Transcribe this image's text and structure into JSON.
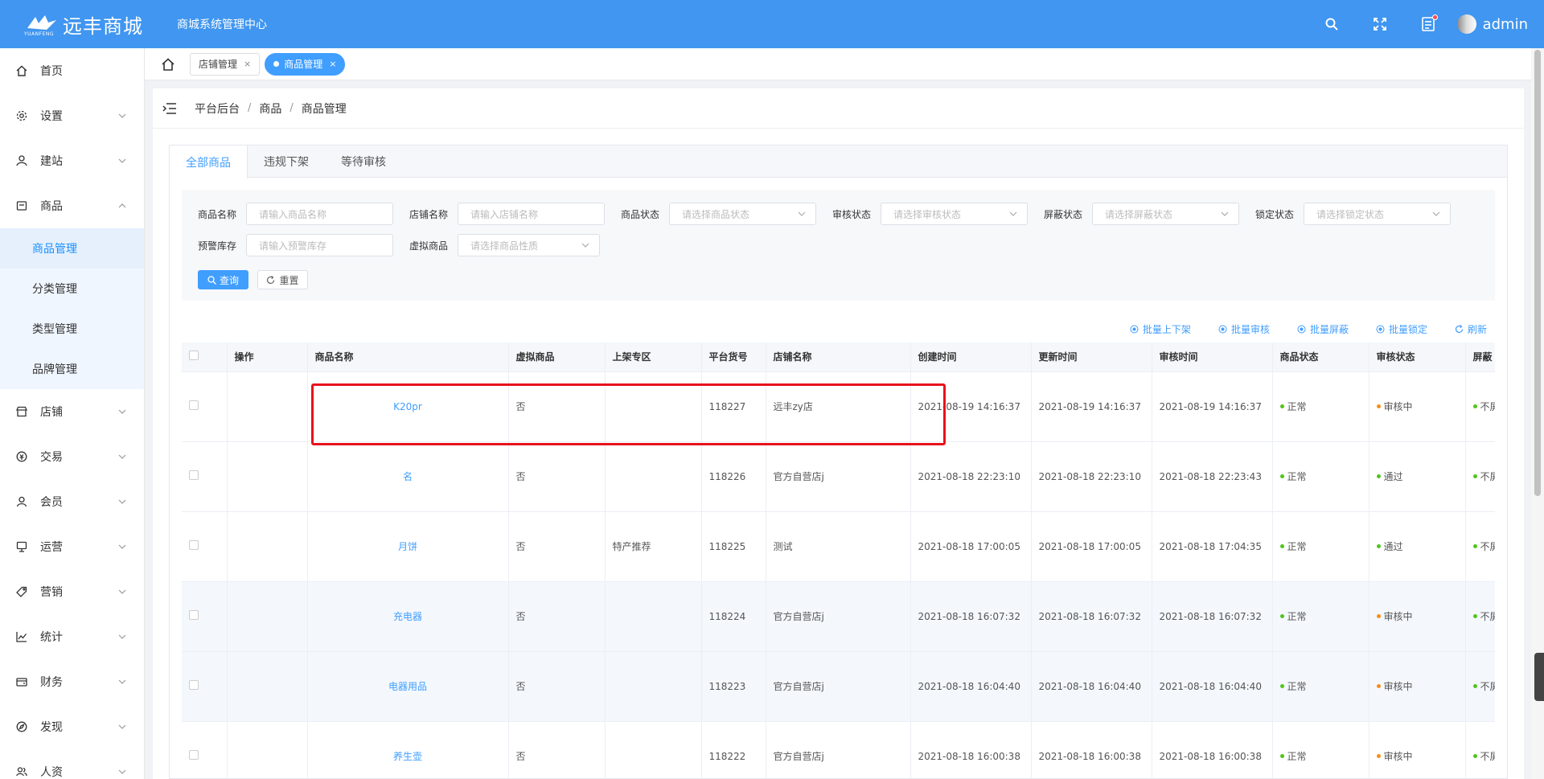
{
  "app": {
    "logo_text": "远丰商城",
    "logo_sub": "YUANFENG",
    "system_name": "商城系统管理中心",
    "username": "admin",
    "colors": {
      "primary": "#4096f0",
      "link": "#409eff",
      "highlight": "#e8121c",
      "status_green": "#52c41a",
      "status_orange": "#fa8c16"
    }
  },
  "header_icons": [
    "search-icon",
    "fullscreen-icon",
    "message-icon"
  ],
  "sidebar": {
    "items": [
      {
        "label": "首页",
        "icon": "home-icon",
        "expandable": false
      },
      {
        "label": "设置",
        "icon": "gear-icon",
        "expandable": true
      },
      {
        "label": "建站",
        "icon": "site-icon",
        "expandable": true
      },
      {
        "label": "商品",
        "icon": "goods-icon",
        "expandable": true,
        "expanded": true,
        "children": [
          {
            "label": "商品管理",
            "active": true
          },
          {
            "label": "分类管理"
          },
          {
            "label": "类型管理"
          },
          {
            "label": "品牌管理"
          }
        ]
      },
      {
        "label": "店铺",
        "icon": "store-icon",
        "expandable": true
      },
      {
        "label": "交易",
        "icon": "trade-icon",
        "expandable": true
      },
      {
        "label": "会员",
        "icon": "user-icon",
        "expandable": true
      },
      {
        "label": "运营",
        "icon": "operate-icon",
        "expandable": true
      },
      {
        "label": "营销",
        "icon": "tag-icon",
        "expandable": true
      },
      {
        "label": "统计",
        "icon": "chart-icon",
        "expandable": true
      },
      {
        "label": "财务",
        "icon": "finance-icon",
        "expandable": true
      },
      {
        "label": "发现",
        "icon": "compass-icon",
        "expandable": true
      },
      {
        "label": "人资",
        "icon": "staff-icon",
        "expandable": true
      }
    ]
  },
  "tabs": [
    {
      "label": "店铺管理",
      "close": "×",
      "active": false
    },
    {
      "label": "商品管理",
      "close": "×",
      "active": true
    }
  ],
  "breadcrumb": {
    "items": [
      "平台后台",
      "商品",
      "商品管理"
    ],
    "separator": "/"
  },
  "panel_tabs": [
    "全部商品",
    "违规下架",
    "等待审核"
  ],
  "filters": {
    "row1": [
      {
        "label": "商品名称",
        "placeholder": "请输入商品名称",
        "type": "input"
      },
      {
        "label": "店铺名称",
        "placeholder": "请输入店铺名称",
        "type": "input"
      },
      {
        "label": "商品状态",
        "placeholder": "请选择商品状态",
        "type": "select"
      },
      {
        "label": "审核状态",
        "placeholder": "请选择审核状态",
        "type": "select"
      },
      {
        "label": "屏蔽状态",
        "placeholder": "请选择屏蔽状态",
        "type": "select"
      },
      {
        "label": "锁定状态",
        "placeholder": "请选择锁定状态",
        "type": "select"
      }
    ],
    "row2": [
      {
        "label": "预警库存",
        "placeholder": "请输入预警库存",
        "type": "input"
      },
      {
        "label": "虚拟商品",
        "placeholder": "请选择商品性质",
        "type": "select"
      }
    ],
    "query_label": "查询",
    "reset_label": "重置"
  },
  "actions": [
    "批量上下架",
    "批量审核",
    "批量屏蔽",
    "批量锁定",
    "刷新"
  ],
  "table": {
    "columns": [
      "操作",
      "商品名称",
      "虚拟商品",
      "上架专区",
      "平台货号",
      "店铺名称",
      "创建时间",
      "更新时间",
      "审核时间",
      "商品状态",
      "审核状态",
      "屏蔽"
    ],
    "rows": [
      {
        "name": "K20pr",
        "virtual": "否",
        "zone": "",
        "sku": "118227",
        "store": "远丰zy店",
        "created": "2021-08-19 14:16:37",
        "updated": "2021-08-19 14:16:37",
        "audited": "2021-08-19 14:16:37",
        "status": "正常",
        "audit": "审核中",
        "shield": "不屏"
      },
      {
        "name": "名",
        "virtual": "否",
        "zone": "",
        "sku": "118226",
        "store": "官方自营店j",
        "created": "2021-08-18 22:23:10",
        "updated": "2021-08-18 22:23:10",
        "audited": "2021-08-18 22:23:43",
        "status": "正常",
        "audit": "通过",
        "shield": "不屏"
      },
      {
        "name": "月饼",
        "virtual": "否",
        "zone": "特产推荐",
        "sku": "118225",
        "store": "测试",
        "created": "2021-08-18 17:00:05",
        "updated": "2021-08-18 17:00:05",
        "audited": "2021-08-18 17:04:35",
        "status": "正常",
        "audit": "通过",
        "shield": "不屏"
      },
      {
        "name": "充电器",
        "virtual": "否",
        "zone": "",
        "sku": "118224",
        "store": "官方自营店j",
        "created": "2021-08-18 16:07:32",
        "updated": "2021-08-18 16:07:32",
        "audited": "2021-08-18 16:07:32",
        "status": "正常",
        "audit": "审核中",
        "shield": "不屏"
      },
      {
        "name": "电器用品",
        "virtual": "否",
        "zone": "",
        "sku": "118223",
        "store": "官方自营店j",
        "created": "2021-08-18 16:04:40",
        "updated": "2021-08-18 16:04:40",
        "audited": "2021-08-18 16:04:40",
        "status": "正常",
        "audit": "审核中",
        "shield": "不屏"
      },
      {
        "name": "养生壶",
        "virtual": "否",
        "zone": "",
        "sku": "118222",
        "store": "官方自营店j",
        "created": "2021-08-18 16:00:38",
        "updated": "2021-08-18 16:00:38",
        "audited": "2021-08-18 16:00:38",
        "status": "正常",
        "audit": "审核中",
        "shield": "不屏"
      }
    ]
  }
}
